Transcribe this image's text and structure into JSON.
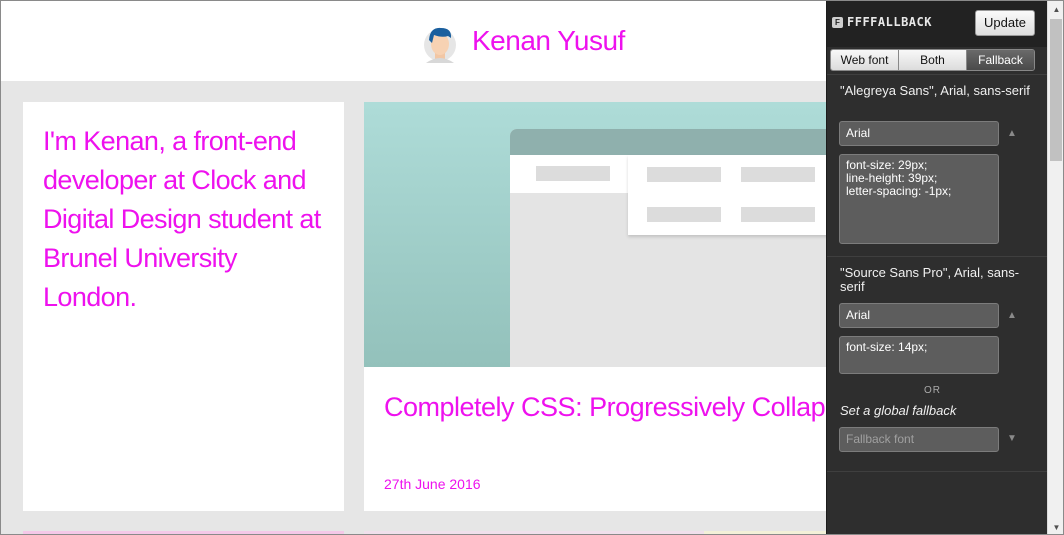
{
  "site": {
    "title": "Kenan Yusuf",
    "intro": "I'm Kenan, a front-end developer at Clock and Digital Design student at Brunel University London.",
    "post": {
      "title": "Completely CSS: Progressively Collapsing Navigation",
      "date": "27th June 2016"
    },
    "accent_color": "#ee11ee"
  },
  "panel": {
    "logo": "FFFFALLBACK",
    "logo_icon": "F",
    "update_label": "Update",
    "tabs": [
      "Web font",
      "Both",
      "Fallback"
    ],
    "active_tab": "Fallback",
    "fonts": [
      {
        "name": "\"Alegreya Sans\", Arial, sans-serif",
        "fallback": "Arial",
        "css": "font-size: 29px;\nline-height: 39px;\nletter-spacing: -1px;"
      },
      {
        "name": "\"Source Sans Pro\", Arial, sans-serif",
        "fallback": "Arial",
        "css": "font-size: 14px;"
      }
    ],
    "or_label": "OR",
    "global_label": "Set a global fallback",
    "global_placeholder": "Fallback font"
  },
  "icons": {
    "select_arrow_up": "▲",
    "select_arrow_down": "▼",
    "scroll_up": "▲",
    "scroll_down": "▼"
  }
}
